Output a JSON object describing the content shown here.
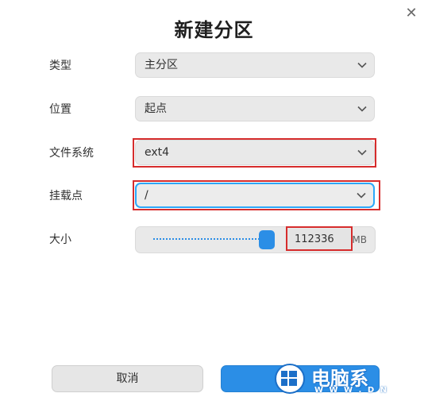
{
  "dialog": {
    "title": "新建分区",
    "close_glyph": "✕"
  },
  "fields": {
    "type": {
      "label": "类型",
      "value": "主分区"
    },
    "position": {
      "label": "位置",
      "value": "起点"
    },
    "filesystem": {
      "label": "文件系统",
      "value": "ext4"
    },
    "mount_point": {
      "label": "挂载点",
      "value": "/"
    },
    "size": {
      "label": "大小",
      "value": "112336",
      "unit": "MB",
      "slider_fraction": 0.95
    }
  },
  "buttons": {
    "cancel": "取消",
    "create": ""
  },
  "watermark": {
    "text": "电脑系",
    "sub": "W W W . D N"
  },
  "colors": {
    "accent": "#2b8ee6",
    "focus_border": "#2ca7f8",
    "highlight": "#d62c2c"
  }
}
